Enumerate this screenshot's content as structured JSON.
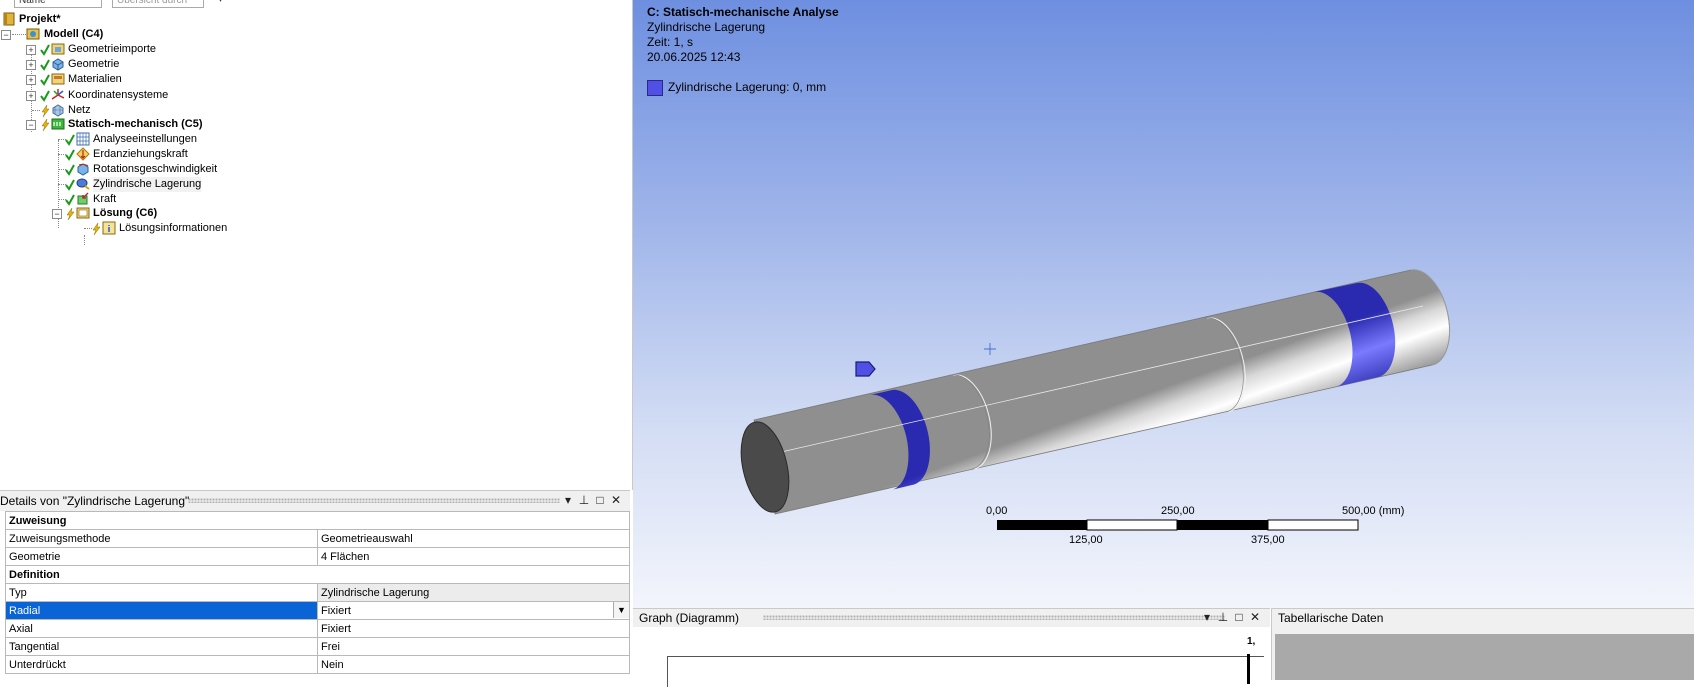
{
  "tree": {
    "filter": {
      "name_value": "Name",
      "search_placeholder": "Übersicht durch"
    },
    "root": "Projekt*",
    "items": [
      {
        "label": "Modell (C4)"
      },
      {
        "label": "Geometrieimporte"
      },
      {
        "label": "Geometrie"
      },
      {
        "label": "Materialien"
      },
      {
        "label": "Koordinatensysteme"
      },
      {
        "label": "Netz"
      },
      {
        "label": "Statisch-mechanisch (C5)"
      },
      {
        "label": "Analyseeinstellungen"
      },
      {
        "label": "Erdanziehungskraft"
      },
      {
        "label": "Rotationsgeschwindigkeit"
      },
      {
        "label": "Zylindrische Lagerung"
      },
      {
        "label": "Kraft"
      },
      {
        "label": "Lösung (C6)"
      },
      {
        "label": "Lösungsinformationen"
      }
    ]
  },
  "details": {
    "title": "Details von \"Zylindrische Lagerung\"",
    "groups": [
      {
        "name": "Zuweisung",
        "rows": [
          {
            "key": "Zuweisungsmethode",
            "value": "Geometrieauswahl"
          },
          {
            "key": "Geometrie",
            "value": "4 Flächen"
          }
        ]
      },
      {
        "name": "Definition",
        "rows": [
          {
            "key": "Typ",
            "value": "Zylindrische Lagerung"
          },
          {
            "key": "Radial",
            "value": "Fixiert"
          },
          {
            "key": "Axial",
            "value": "Fixiert"
          },
          {
            "key": "Tangential",
            "value": "Frei"
          },
          {
            "key": "Unterdrückt",
            "value": "Nein"
          }
        ]
      }
    ]
  },
  "viewport": {
    "title_lines": [
      "C: Statisch-mechanische Analyse",
      "Zylindrische Lagerung",
      "Zeit: 1, s",
      "20.06.2025 12:43"
    ],
    "legend": "Zylindrische Lagerung: 0, mm",
    "legend_color": "#5050e6",
    "scale": {
      "top_labels": [
        "0,00",
        "250,00",
        "500,00 (mm)"
      ],
      "bottom_labels": [
        "125,00",
        "375,00"
      ]
    }
  },
  "graph": {
    "title": "Graph (Diagramm)",
    "marker": "1,"
  },
  "tabular": {
    "title": "Tabellarische Daten"
  },
  "colors": {
    "selection": "#0a64d6",
    "support_face": "#5050e6",
    "shaft": "#d4d4d4"
  }
}
